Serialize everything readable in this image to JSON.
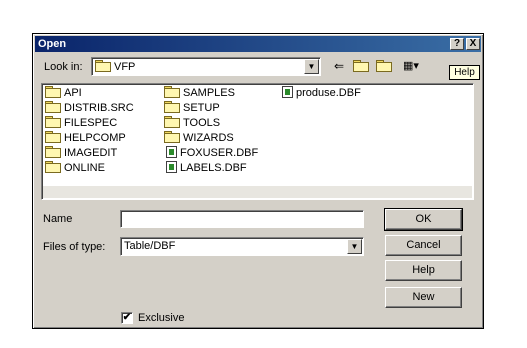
{
  "window": {
    "title": "Open",
    "help_btn": "?",
    "close_btn": "X"
  },
  "lookin": {
    "label": "Look in:",
    "value": "VFP"
  },
  "toolbar": {
    "back_icon": "arrow-left-icon",
    "up_icon": "up-folder-icon",
    "new_icon": "new-folder-icon",
    "view_icon": "view-menu-icon",
    "help_label": "Help"
  },
  "files": {
    "col1": [
      "API",
      "DISTRIB.SRC",
      "FILESPEC",
      "HELPCOMP",
      "IMAGEDIT",
      "ONLINE"
    ],
    "col2": [
      "SAMPLES",
      "SETUP",
      "TOOLS",
      "WIZARDS"
    ],
    "col2_dbf": [
      "FOXUSER.DBF",
      "LABELS.DBF"
    ],
    "col3_dbf": [
      "produse.DBF"
    ]
  },
  "name": {
    "label": "Name",
    "value": ""
  },
  "filetype": {
    "label": "Files of type:",
    "value": "Table/DBF"
  },
  "buttons": {
    "ok": "OK",
    "cancel": "Cancel",
    "help": "Help",
    "new": "New"
  },
  "exclusive": {
    "label": "Exclusive",
    "checked": true,
    "mark": "✔"
  }
}
